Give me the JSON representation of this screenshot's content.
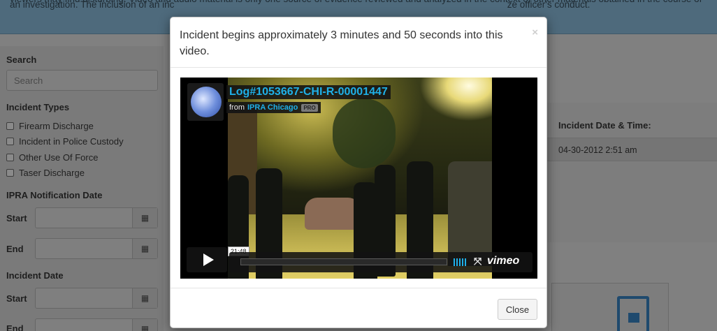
{
  "background": {
    "notice": {
      "line1": "viewers may find disturbing. Video and audio material is only one source of evidence reviewed and analyzed in the context of other materials obtained in the course of",
      "line2": "an investigation. The inclusion of an inc                                                                                                                               ze officer's conduct."
    },
    "sidebar": {
      "search_heading": "Search",
      "search_placeholder": "Search",
      "incident_types_heading": "Incident Types",
      "incident_types": [
        "Firearm Discharge",
        "Incident in Police Custody",
        "Other Use Of Force",
        "Taser Discharge"
      ],
      "notification_heading": "IPRA Notification Date",
      "incident_date_heading": "Incident Date",
      "start_label": "Start",
      "end_label": "End"
    },
    "results": {
      "column_header": "Incident Date & Time:",
      "first_value": "04-30-2012 2:51 am"
    }
  },
  "modal": {
    "title": "Incident begins approximately 3 minutes and 50 seconds into this video.",
    "close_x": "×",
    "video": {
      "title": "Log#1053667-CHI-R-00001447",
      "from_label": "from",
      "channel": "IPRA Chicago",
      "badge": "PRO",
      "time_tooltip": "21:48",
      "brand": "vimeo",
      "progress": 0
    },
    "footer": {
      "close_button": "Close"
    }
  },
  "colors": {
    "vimeo_blue": "#1fb0e8",
    "overlay_grey": "#808080"
  }
}
